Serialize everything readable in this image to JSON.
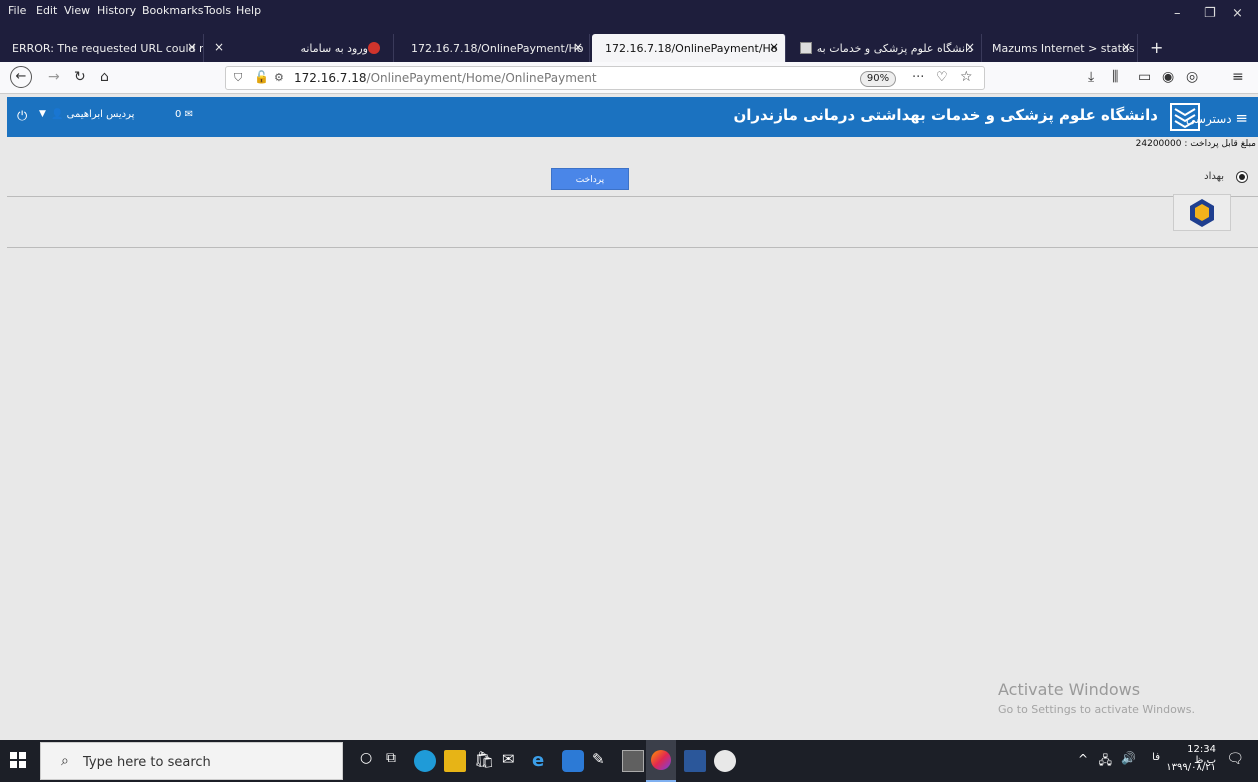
{
  "browser": {
    "menu": [
      "File",
      "Edit",
      "View",
      "History",
      "Bookmarks",
      "Tools",
      "Help"
    ],
    "tabs": [
      {
        "label": "ERROR: The requested URL could n"
      },
      {
        "label": "ورود به سامانه"
      },
      {
        "label": "172.16.7.18/OnlinePayment/Ho"
      },
      {
        "label": "172.16.7.18/OnlinePayment/Ho"
      },
      {
        "label": "دانشگاه علوم پزشکی و خدمات به"
      },
      {
        "label": "Mazums Internet > status"
      }
    ],
    "url_host": "172.16.7.18",
    "url_path": "/OnlinePayment/Home/OnlinePayment",
    "zoom": "90%"
  },
  "site": {
    "title": "دانشگاه علوم پزشکی و خدمات بهداشتی درمانی مازندران",
    "menu_label": "دسترسی",
    "user_label": "پردیس ابراهیمی",
    "message_count": "0"
  },
  "payment": {
    "amount_label": "مبلغ قابل پرداخت : 24200000",
    "pay_button": "پرداخت",
    "bank_label": "بهداد"
  },
  "watermark": {
    "line1": "Activate Windows",
    "line2": "Go to Settings to activate Windows."
  },
  "taskbar": {
    "search_placeholder": "Type here to search",
    "time": "12:34 ب.ظ",
    "date": "۱۳۹۹/۰۸/۲۱",
    "lang": "فا"
  }
}
